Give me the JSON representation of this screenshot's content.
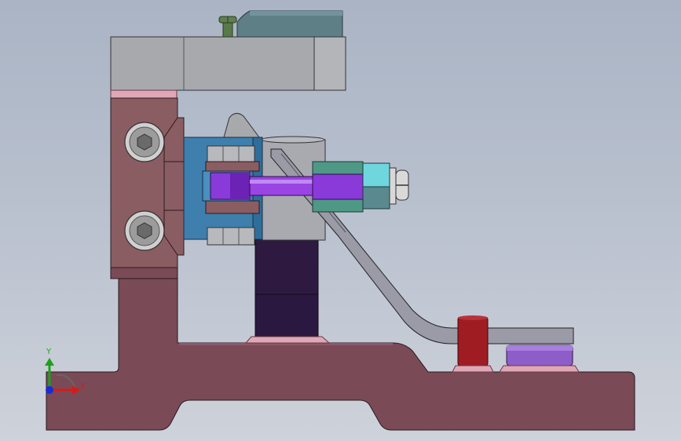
{
  "viewport": {
    "background_top": "#aab4c4",
    "background_bottom": "#ced2da"
  },
  "triad": {
    "x_label": "X",
    "y_label": "Y",
    "x_color": "#d81a1a",
    "y_color": "#1ea01e",
    "z_color": "#1a2ad8"
  },
  "colors": {
    "base_plate": "#7a4a57",
    "top_block": "#a7a9ad",
    "cylinder": "#5f7f87",
    "blue_block": "#3e7fae",
    "purple_rod": "#8a3ad8",
    "teal_nut": "#5aa796",
    "cyan_hex_nut": "#6fd6de",
    "dark_pillar": "#2e1a40",
    "red_pin": "#9e1c22",
    "lilac_puck": "#8d5ec8"
  }
}
